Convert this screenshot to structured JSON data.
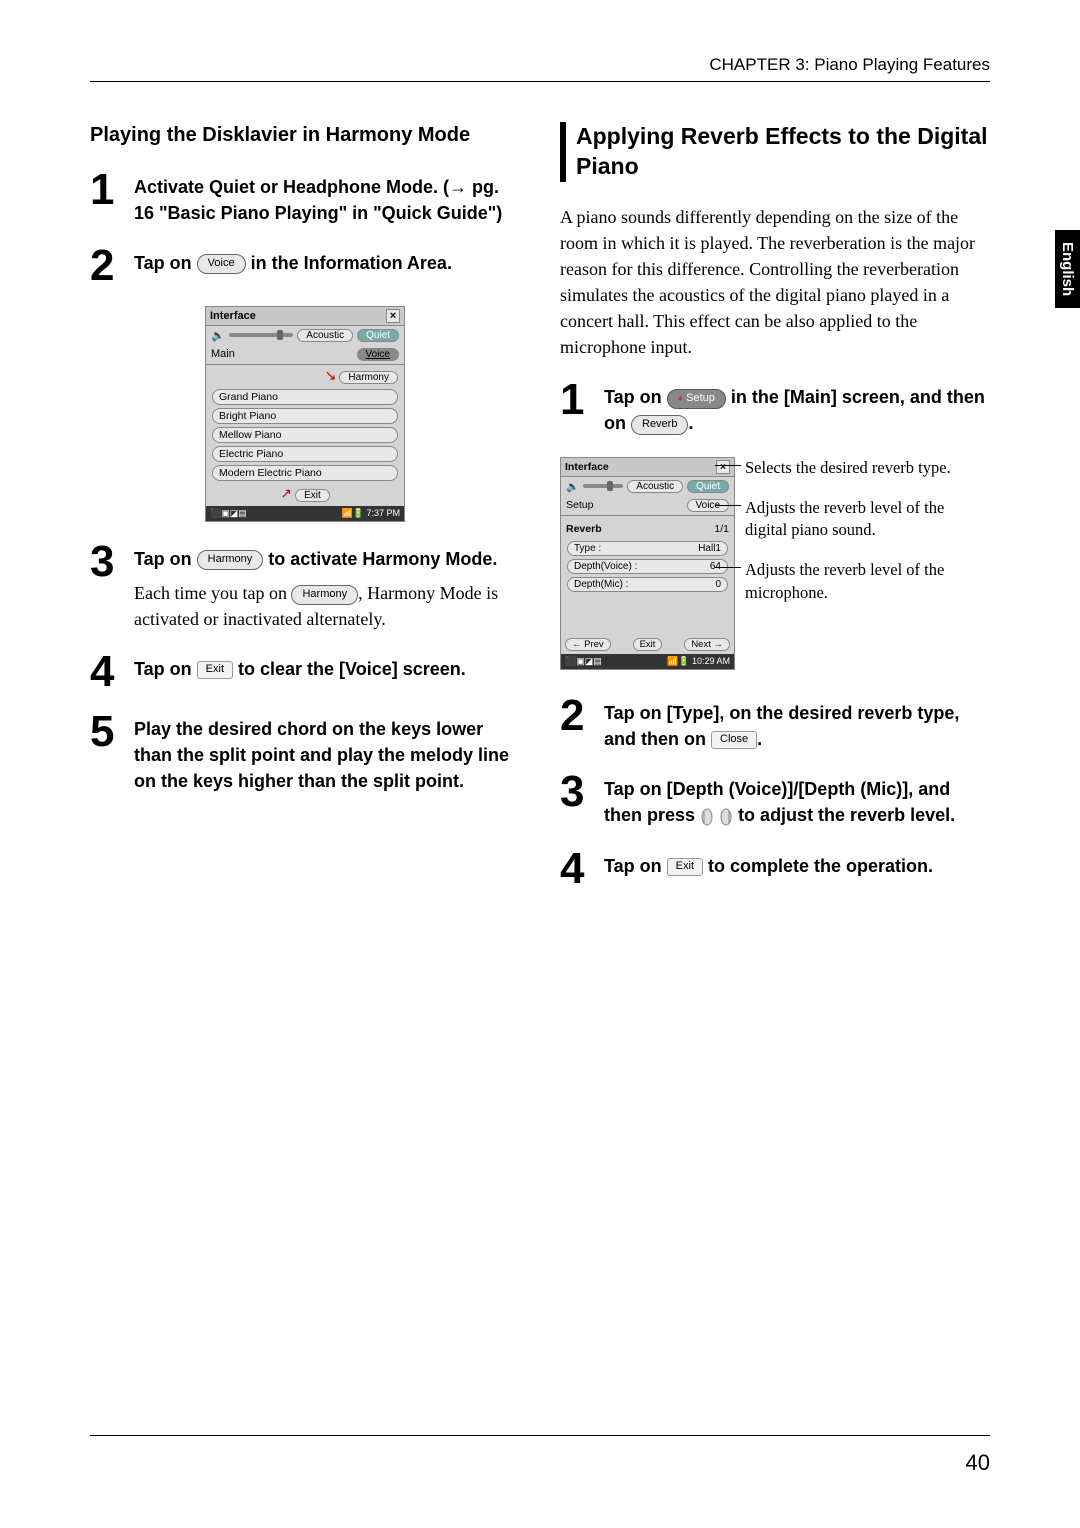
{
  "header": {
    "chapter": "CHAPTER 3: Piano Playing Features"
  },
  "sideTab": "English",
  "pageNumber": "40",
  "left": {
    "heading": "Playing the Disklavier in Harmony Mode",
    "steps": [
      {
        "num": "1",
        "text_a": "Activate Quiet or Headphone Mode. (",
        "arrow": "→",
        "text_b": " pg. 16 \"Basic Piano Playing\" in \"Quick Guide\")"
      },
      {
        "num": "2",
        "text_a": "Tap on ",
        "pill": "Voice",
        "text_b": " in the Information Area."
      },
      {
        "num": "3",
        "text_a": "Tap on ",
        "pill": "Harmony",
        "text_b": " to activate Harmony Mode.",
        "note_a": "Each time you tap on ",
        "note_pill": "Harmony",
        "note_b": ", Harmony Mode is activated or inactivated alternately."
      },
      {
        "num": "4",
        "text_a": "Tap on ",
        "chip": "Exit",
        "text_b": " to clear the [Voice] screen."
      },
      {
        "num": "5",
        "text": "Play the desired chord on the keys lower than the split point and play the melody line on the keys higher than the split point."
      }
    ],
    "device": {
      "title": "Interface",
      "volLabel": "",
      "acoustic": "Acoustic",
      "quiet": "Quiet",
      "main": "Main",
      "voiceTab": "Voice",
      "harmonyBtn": "Harmony",
      "items": [
        "Grand Piano",
        "Bright Piano",
        "Mellow Piano",
        "Electric Piano",
        "Modern Electric Piano"
      ],
      "exit": "Exit",
      "time": "7:37 PM"
    }
  },
  "right": {
    "title": "Applying Reverb Effects to the Digital Piano",
    "intro": "A piano sounds differently depending on the size of the room in which it is played. The reverberation is the major reason for this difference. Controlling the reverberation simulates the acoustics of the digital piano played in a concert hall. This effect can be also applied to the microphone input.",
    "steps": [
      {
        "num": "1",
        "text_a": "Tap on ",
        "pill1": "Setup",
        "text_b": " in the [Main] screen, and then on ",
        "pill2": "Reverb",
        "text_c": "."
      },
      {
        "num": "2",
        "text_a": "Tap on [Type], on the desired reverb type, and then on ",
        "chip": "Close",
        "text_b": "."
      },
      {
        "num": "3",
        "text_a": "Tap on [Depth (Voice)]/[Depth (Mic)], and then press ",
        "text_b": " to adjust the reverb level."
      },
      {
        "num": "4",
        "text_a": "Tap on ",
        "chip": "Exit",
        "text_b": " to complete the operation."
      }
    ],
    "device": {
      "title": "Interface",
      "acoustic": "Acoustic",
      "quiet": "Quiet",
      "setup": "Setup",
      "voiceTab": "Voice",
      "reverb": "Reverb",
      "page": "1/1",
      "params": [
        {
          "k": "Type :",
          "v": "Hall1"
        },
        {
          "k": "Depth(Voice) :",
          "v": "64"
        },
        {
          "k": "Depth(Mic) :",
          "v": "0"
        }
      ],
      "prev": "Prev",
      "exit": "Exit",
      "next": "Next",
      "time": "10:29 AM"
    },
    "callouts": [
      "Selects the desired reverb type.",
      "Adjusts the reverb level of the digital piano sound.",
      "Adjusts the reverb level of the microphone."
    ]
  }
}
